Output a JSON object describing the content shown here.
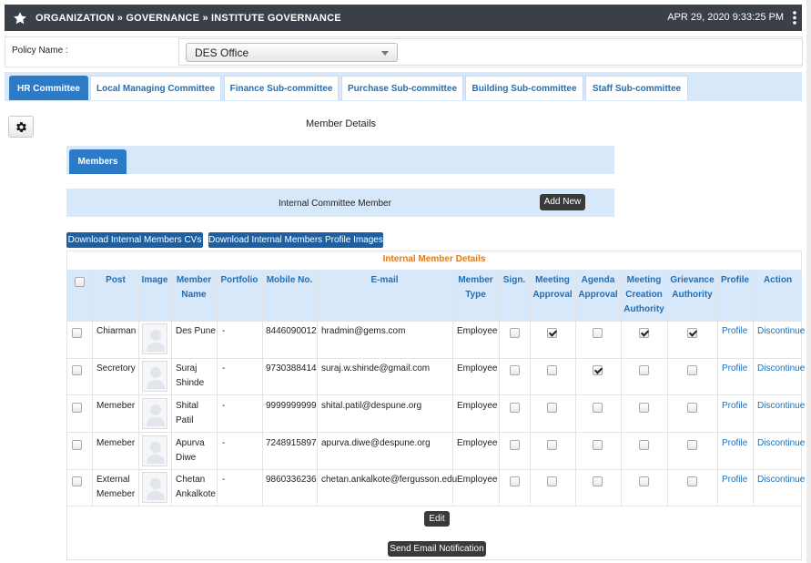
{
  "header": {
    "breadcrumb": "ORGANIZATION » GOVERNANCE » INSTITUTE GOVERNANCE",
    "datetime": "APR 29, 2020  9:33:25 PM"
  },
  "policy": {
    "label": "Policy Name :",
    "selected": "DES Office"
  },
  "tabs": [
    {
      "label": "HR Committee",
      "active": true
    },
    {
      "label": "Local Managing Committee",
      "active": false
    },
    {
      "label": "Finance Sub-committee",
      "active": false
    },
    {
      "label": "Purchase Sub-committee",
      "active": false
    },
    {
      "label": "Building Sub-committee",
      "active": false
    },
    {
      "label": "Staff Sub-committee",
      "active": false
    }
  ],
  "member_details_title": "Member Details",
  "members_tab": "Members",
  "internal_section": {
    "title": "Internal Committee Member",
    "add_new": "Add New"
  },
  "downloads": {
    "cvs": "Download Internal Members CVs",
    "images": "Download Internal Members Profile Images"
  },
  "table": {
    "caption": "Internal Member Details",
    "headers": {
      "post": "Post",
      "image": "Image",
      "member_name_1": "Member",
      "member_name_2": "Name",
      "portfolio": "Portfolio",
      "mobile": "Mobile No.",
      "email": "E-mail",
      "member_type_1": "Member",
      "member_type_2": "Type",
      "sign": "Sign.",
      "meeting_approval_1": "Meeting",
      "meeting_approval_2": "Approval",
      "agenda_approval_1": "Agenda",
      "agenda_approval_2": "Approval",
      "meeting_creation_1": "Meeting",
      "meeting_creation_2": "Creation",
      "meeting_creation_3": "Authority",
      "grievance_1": "Grievance",
      "grievance_2": "Authority",
      "profile": "Profile",
      "action": "Action"
    },
    "rows": [
      {
        "post": "Chiarman",
        "post_2": "",
        "name": "Des Pune",
        "name_2": "",
        "portfolio": "-",
        "mobile": "8446090012",
        "email": "hradmin@gems.com",
        "type": "Employee",
        "sign": false,
        "meeting_approval": true,
        "agenda_approval": false,
        "meeting_creation": true,
        "grievance": true,
        "profile": "Profile",
        "action": "Discontinue"
      },
      {
        "post": "Secretory",
        "post_2": "",
        "name": "Suraj",
        "name_2": "Shinde",
        "portfolio": "-",
        "mobile": "9730388414",
        "email": "suraj.w.shinde@gmail.com",
        "type": "Employee",
        "sign": false,
        "meeting_approval": false,
        "agenda_approval": true,
        "meeting_creation": false,
        "grievance": false,
        "profile": "Profile",
        "action": "Discontinue"
      },
      {
        "post": "Memeber",
        "post_2": "",
        "name": "Shital",
        "name_2": "Patil",
        "portfolio": "-",
        "mobile": "9999999999",
        "email": "shital.patil@despune.org",
        "type": "Employee",
        "sign": false,
        "meeting_approval": false,
        "agenda_approval": false,
        "meeting_creation": false,
        "grievance": false,
        "profile": "Profile",
        "action": "Discontinue"
      },
      {
        "post": "Memeber",
        "post_2": "",
        "name": "Apurva",
        "name_2": "Diwe",
        "portfolio": "-",
        "mobile": "7248915897",
        "email": "apurva.diwe@despune.org",
        "type": "Employee",
        "sign": false,
        "meeting_approval": false,
        "agenda_approval": false,
        "meeting_creation": false,
        "grievance": false,
        "profile": "Profile",
        "action": "Discontinue"
      },
      {
        "post": "External",
        "post_2": "Memeber",
        "name": "Chetan",
        "name_2": "Ankalkote",
        "portfolio": "-",
        "mobile": "9860336236",
        "email": "chetan.ankalkote@fergusson.edu",
        "type": "Employee",
        "sign": false,
        "meeting_approval": false,
        "agenda_approval": false,
        "meeting_creation": false,
        "grievance": false,
        "profile": "Profile",
        "action": "Discontinue"
      }
    ]
  },
  "buttons": {
    "edit": "Edit",
    "send_email": "Send Email Notification"
  },
  "icons": {
    "header": "star-icon",
    "menu": "kebab-menu-icon",
    "settings": "gear-icon",
    "avatar": "user-placeholder-icon"
  }
}
